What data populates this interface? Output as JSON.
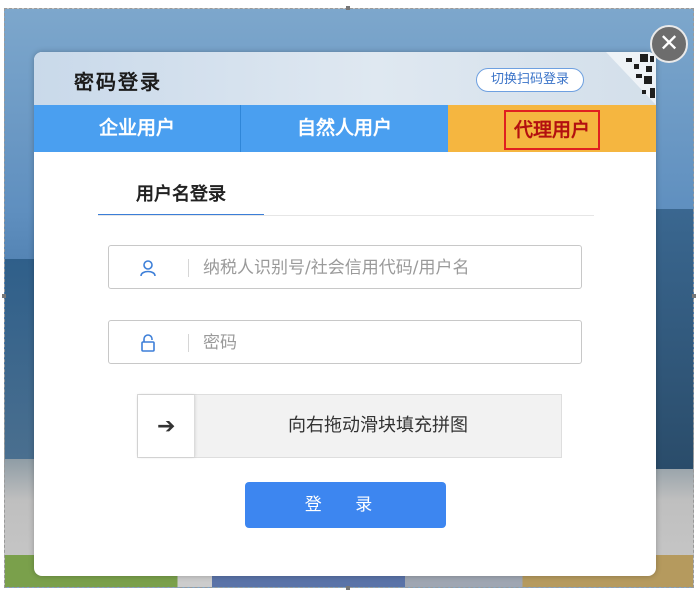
{
  "dialog": {
    "title": "密码登录",
    "switch_qr_label": "切换扫码登录"
  },
  "tabs": [
    {
      "label": "企业用户"
    },
    {
      "label": "自然人用户"
    },
    {
      "label": "代理用户",
      "selected": true
    }
  ],
  "subtab": {
    "label": "用户名登录"
  },
  "form": {
    "username_placeholder": "纳税人识别号/社会信用代码/用户名",
    "password_placeholder": "密码",
    "slider_text": "向右拖动滑块填充拼图",
    "login_label": "登 录"
  },
  "icons": {
    "user": "user-icon",
    "lock": "lock-icon",
    "arrow": "arrow-right-icon",
    "close": "close-icon",
    "qr": "qr-code-icon"
  },
  "colors": {
    "tab_blue": "#4a9ff0",
    "tab_selected": "#f5b640",
    "highlight_border": "#e02020",
    "primary_button": "#3d86f0"
  }
}
